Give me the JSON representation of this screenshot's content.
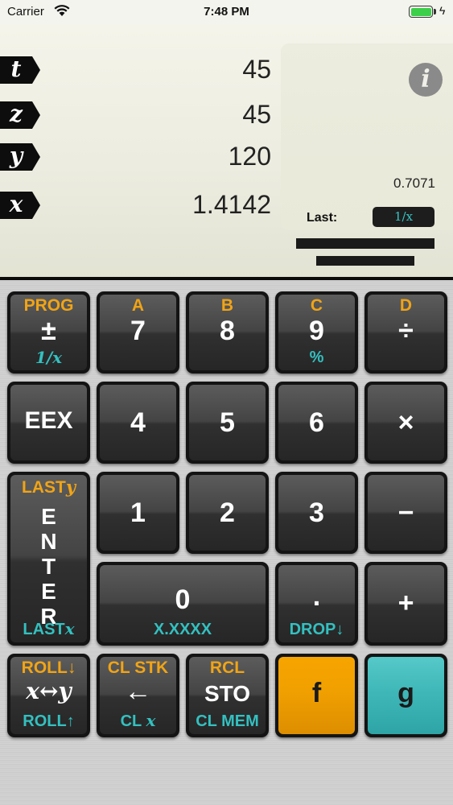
{
  "status": {
    "carrier": "Carrier",
    "time": "7:48 PM",
    "charging_icon": "bolt-icon"
  },
  "display": {
    "registers": [
      {
        "tag": "t",
        "value": "45"
      },
      {
        "tag": "z",
        "value": "45"
      },
      {
        "tag": "y",
        "value": "120"
      },
      {
        "tag": "x",
        "value": "1.4142"
      }
    ],
    "info_icon": "i",
    "aux_value": "0.7071",
    "last_label": "Last:",
    "last_key": "1/x"
  },
  "keys": {
    "chs": {
      "top": "PROG",
      "main": "±",
      "bottom": "1/x"
    },
    "k7": {
      "top": "A",
      "main": "7"
    },
    "k8": {
      "top": "B",
      "main": "8"
    },
    "k9": {
      "top": "C",
      "main": "9",
      "bottom": "%"
    },
    "div": {
      "top": "D",
      "main": "÷"
    },
    "eex": {
      "main": "EEX"
    },
    "k4": {
      "main": "4"
    },
    "k5": {
      "main": "5"
    },
    "k6": {
      "main": "6"
    },
    "mul": {
      "main": "×"
    },
    "enter": {
      "top": "LAST",
      "top_suffix": "y",
      "letters": [
        "E",
        "N",
        "T",
        "E",
        "R"
      ],
      "bottom": "LAST",
      "bottom_suffix": "x"
    },
    "k1": {
      "main": "1"
    },
    "k2": {
      "main": "2"
    },
    "k3": {
      "main": "3"
    },
    "sub": {
      "main": "−"
    },
    "k0": {
      "main": "0",
      "bottom": "X.XXXX"
    },
    "dot": {
      "main": ".",
      "bottom": "DROP↓"
    },
    "add": {
      "main": "+"
    },
    "swap": {
      "top": "ROLL↓",
      "main": "x↔y",
      "bottom": "ROLL↑"
    },
    "back": {
      "top": "CL STK",
      "main": "←",
      "bottom": "CL",
      "bottom_suffix": "x"
    },
    "sto": {
      "top": "RCL",
      "main": "STO",
      "bottom": "CL MEM"
    },
    "f": {
      "main": "f"
    },
    "g": {
      "main": "g"
    }
  },
  "colors": {
    "shift_orange": "#f0a416",
    "shift_teal": "#34c0c0",
    "f_key": "#f0a000",
    "g_key": "#3fb7b8"
  }
}
